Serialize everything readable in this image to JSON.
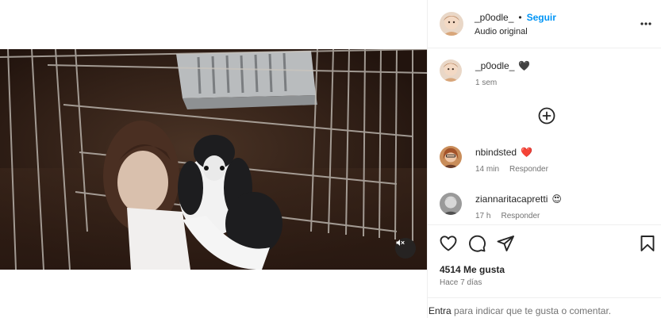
{
  "post": {
    "author": "_p0odle_",
    "separator": "•",
    "follow_label": "Seguir",
    "audio": "Audio original",
    "more_icon": "more-horizontal-icon"
  },
  "caption": {
    "user": "_p0odle_",
    "emoji": "🖤",
    "time": "1 sem"
  },
  "load_more_icon": "plus-circle-icon",
  "comments": [
    {
      "user": "nbindsted",
      "emoji": "❤️",
      "time": "14 min",
      "reply": "Responder"
    },
    {
      "user": "ziannaritacapretti",
      "emoji": "😍",
      "time": "17 h",
      "reply": "Responder"
    }
  ],
  "actions": {
    "icons": [
      "heart-icon",
      "comment-icon",
      "share-icon",
      "bookmark-icon"
    ],
    "likes": "4514 Me gusta",
    "date": "Hace 7 días"
  },
  "login_prompt": {
    "link": "Entra",
    "text": " para indicar que te gusta o comentar."
  },
  "video": {
    "mute_icon": "volume-muted-icon"
  },
  "colors": {
    "accent": "#0095f6",
    "heart": "#ed4956",
    "text": "#262626",
    "muted": "#737373",
    "border": "#efefef"
  }
}
